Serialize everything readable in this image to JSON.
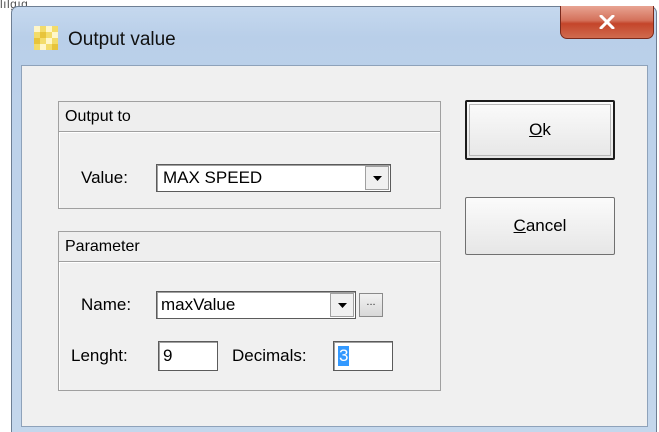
{
  "window": {
    "title": "Output value",
    "close_glyph": "x"
  },
  "top_fragment": "lılgıg",
  "output_group": {
    "header": "Output to",
    "value_label": "Value:",
    "value_selected": "MAX SPEED"
  },
  "parameter_group": {
    "header": "Parameter",
    "name_label": "Name:",
    "name_selected": "maxValue",
    "browse_label": "...",
    "length_label": "Lenght:",
    "length_value": "9",
    "decimals_label": "Decimals:",
    "decimals_value": "3"
  },
  "buttons": {
    "ok_access": "O",
    "ok_rest": "k",
    "cancel_access": "C",
    "cancel_rest": "ancel"
  },
  "icons": [
    "app-icon",
    "close-icon",
    "dropdown-arrow-icon"
  ]
}
